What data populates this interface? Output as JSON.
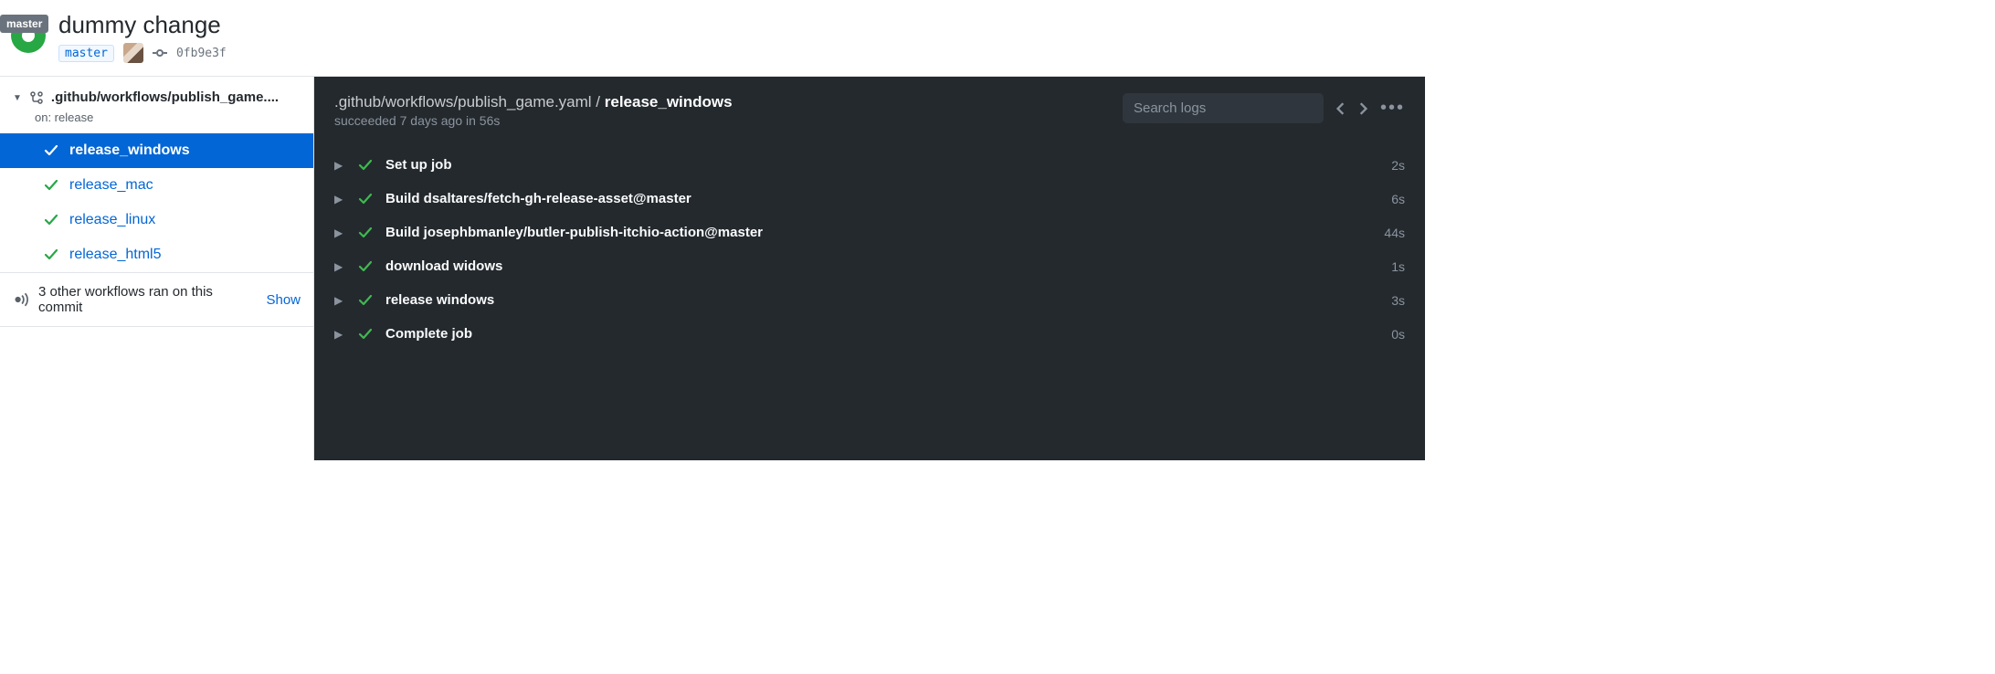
{
  "badge": "master",
  "header": {
    "title": "dummy change",
    "branch": "master",
    "commit_sha": "0fb9e3f"
  },
  "sidebar": {
    "workflow_path": ".github/workflows/publish_game....",
    "trigger": "on: release",
    "jobs": [
      {
        "name": "release_windows",
        "selected": true
      },
      {
        "name": "release_mac",
        "selected": false
      },
      {
        "name": "release_linux",
        "selected": false
      },
      {
        "name": "release_html5",
        "selected": false
      }
    ],
    "other_text": "3 other workflows ran on this commit",
    "show_label": "Show"
  },
  "panel": {
    "path": ".github/workflows/publish_game.yaml / ",
    "job": "release_windows",
    "status_line": "succeeded 7 days ago in 56s",
    "search_placeholder": "Search logs",
    "steps": [
      {
        "name": "Set up job",
        "time": "2s"
      },
      {
        "name": "Build dsaltares/fetch-gh-release-asset@master",
        "time": "6s"
      },
      {
        "name": "Build josephbmanley/butler-publish-itchio-action@master",
        "time": "44s"
      },
      {
        "name": "download widows",
        "time": "1s"
      },
      {
        "name": "release windows",
        "time": "3s"
      },
      {
        "name": "Complete job",
        "time": "0s"
      }
    ]
  }
}
